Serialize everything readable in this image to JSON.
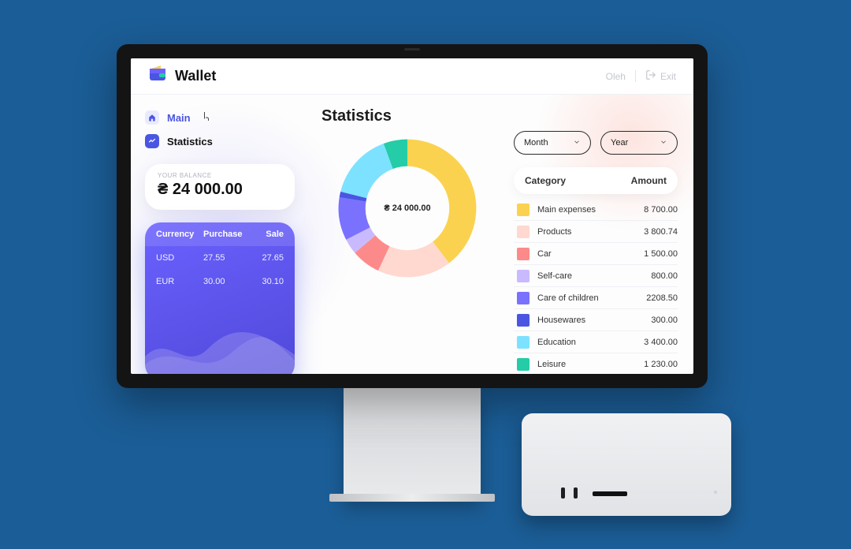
{
  "header": {
    "brand": "Wallet",
    "user": "Oleh",
    "exit_label": "Exit"
  },
  "sidebar": {
    "nav": [
      {
        "label": "Main"
      },
      {
        "label": "Statistics"
      }
    ],
    "balance": {
      "label": "YOUR BALANCE",
      "currency_prefix": "₴",
      "value": "24 000.00"
    },
    "rates": {
      "headers": {
        "currency": "Currency",
        "purchase": "Purchase",
        "sale": "Sale"
      },
      "rows": [
        {
          "currency": "USD",
          "purchase": "27.55",
          "sale": "27.65"
        },
        {
          "currency": "EUR",
          "purchase": "30.00",
          "sale": "30.10"
        }
      ]
    }
  },
  "stats": {
    "title": "Statistics",
    "center_label": "₴ 24 000.00",
    "month_label": "Month",
    "year_label": "Year",
    "table": {
      "category_header": "Category",
      "amount_header": "Amount",
      "rows": [
        {
          "name": "Main expenses",
          "amount": "8 700.00",
          "color": "#fbd24f"
        },
        {
          "name": "Products",
          "amount": "3 800.74",
          "color": "#ffd8d0"
        },
        {
          "name": "Car",
          "amount": "1 500.00",
          "color": "#fd8a8a"
        },
        {
          "name": "Self-care",
          "amount": "800.00",
          "color": "#c9baff"
        },
        {
          "name": "Care of children",
          "amount": "2208.50",
          "color": "#7a71ff"
        },
        {
          "name": "Housewares",
          "amount": "300.00",
          "color": "#4a56e2"
        },
        {
          "name": "Education",
          "amount": "3 400.00",
          "color": "#7de2ff"
        },
        {
          "name": "Leisure",
          "amount": "1 230.00",
          "color": "#24cca7"
        }
      ]
    }
  },
  "chart_data": {
    "type": "pie",
    "title": "Statistics",
    "series": [
      {
        "name": "Main expenses",
        "value": 8700.0,
        "color": "#fbd24f"
      },
      {
        "name": "Products",
        "value": 3800.74,
        "color": "#ffd8d0"
      },
      {
        "name": "Car",
        "value": 1500.0,
        "color": "#fd8a8a"
      },
      {
        "name": "Self-care",
        "value": 800.0,
        "color": "#c9baff"
      },
      {
        "name": "Care of children",
        "value": 2208.5,
        "color": "#7a71ff"
      },
      {
        "name": "Housewares",
        "value": 300.0,
        "color": "#4a56e2"
      },
      {
        "name": "Education",
        "value": 3400.0,
        "color": "#7de2ff"
      },
      {
        "name": "Leisure",
        "value": 1230.0,
        "color": "#24cca7"
      }
    ],
    "center_label": "₴ 24 000.00"
  }
}
